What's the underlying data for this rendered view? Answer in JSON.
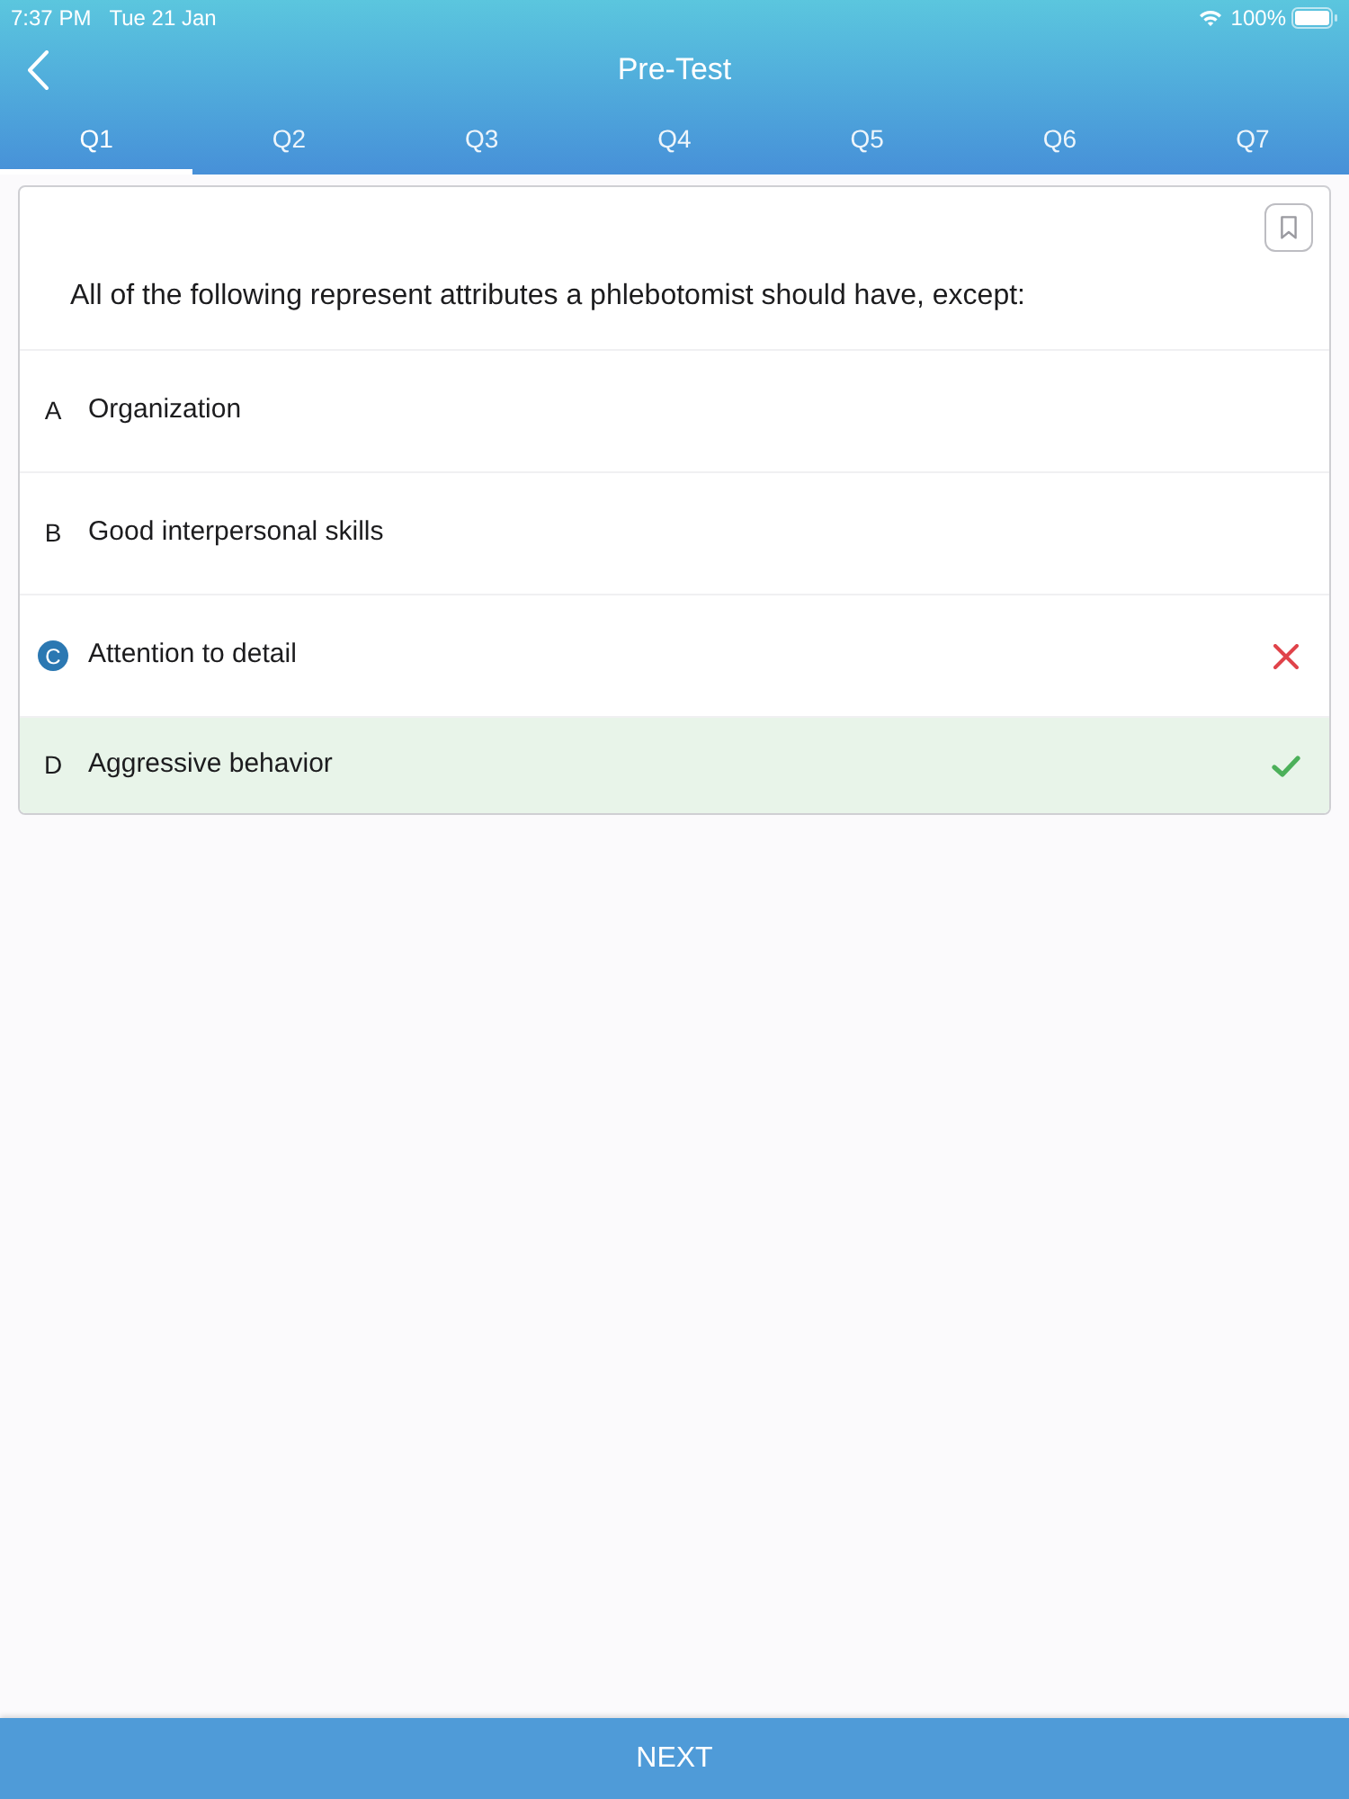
{
  "status_bar": {
    "time": "7:37 PM",
    "date": "Tue 21 Jan",
    "battery": "100%"
  },
  "header": {
    "title": "Pre-Test"
  },
  "tabs": [
    {
      "label": "Q1",
      "selected": true
    },
    {
      "label": "Q2",
      "selected": false
    },
    {
      "label": "Q3",
      "selected": false
    },
    {
      "label": "Q4",
      "selected": false
    },
    {
      "label": "Q5",
      "selected": false
    },
    {
      "label": "Q6",
      "selected": false
    },
    {
      "label": "Q7",
      "selected": false
    }
  ],
  "question": {
    "text": "All of the following represent attributes a phlebotomist should have, except:"
  },
  "options": [
    {
      "letter": "A",
      "text": "Organization",
      "selected": false,
      "correct": false
    },
    {
      "letter": "B",
      "text": "Good interpersonal skills",
      "selected": false,
      "correct": false
    },
    {
      "letter": "C",
      "text": "Attention to detail",
      "selected": true,
      "correct": false
    },
    {
      "letter": "D",
      "text": "Aggressive behavior",
      "selected": false,
      "correct": true
    }
  ],
  "next_button": {
    "label": "NEXT"
  }
}
